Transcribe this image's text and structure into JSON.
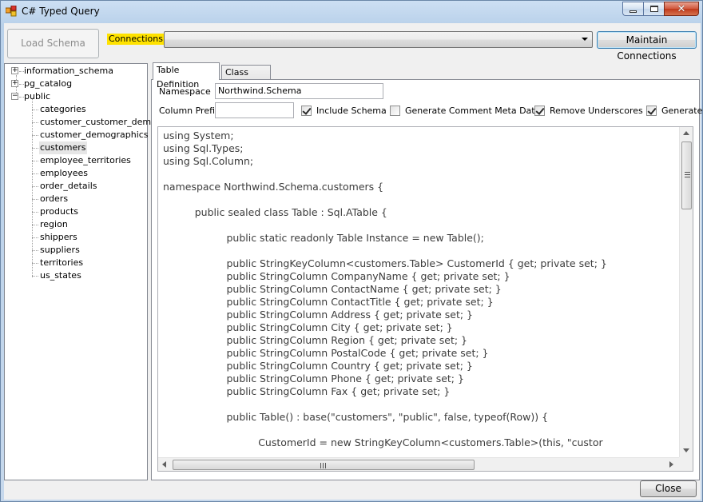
{
  "window": {
    "title": "C# Typed Query"
  },
  "toolbar": {
    "load_schema_label": "Load Schema",
    "connections_label": "Connections",
    "connections_value": "",
    "maintain_connections_label": "Maintain Connections"
  },
  "tree": {
    "roots": [
      {
        "label": "information_schema",
        "expander": "+"
      },
      {
        "label": "pg_catalog",
        "expander": "+"
      },
      {
        "label": "public",
        "expander": "−"
      }
    ],
    "children": [
      "categories",
      "customer_customer_demo",
      "customer_demographics",
      "customers",
      "employee_territories",
      "employees",
      "order_details",
      "orders",
      "products",
      "region",
      "shippers",
      "suppliers",
      "territories",
      "us_states"
    ]
  },
  "tabs": [
    {
      "label": "Table Definition"
    },
    {
      "label": "Class Code"
    }
  ],
  "form": {
    "namespace_label": "Namespace",
    "namespace_value": "Northwind.Schema",
    "column_prefix_label": "Column Prefix",
    "column_prefix_value": "",
    "include_schema_label": "Include Schema",
    "generate_comment_label": "Generate Comment Meta Data",
    "remove_underscores_label": "Remove Underscores",
    "generate_label": "Generate"
  },
  "code_lines": [
    "using System;",
    "using Sql.Types;",
    "using Sql.Column;",
    "",
    "namespace Northwind.Schema.customers {",
    "",
    "          public sealed class Table : Sql.ATable {",
    "",
    "                    public static readonly Table Instance = new Table();",
    "",
    "                    public StringKeyColumn<customers.Table> CustomerId { get; private set; }",
    "                    public StringColumn CompanyName { get; private set; }",
    "                    public StringColumn ContactName { get; private set; }",
    "                    public StringColumn ContactTitle { get; private set; }",
    "                    public StringColumn Address { get; private set; }",
    "                    public StringColumn City { get; private set; }",
    "                    public StringColumn Region { get; private set; }",
    "                    public StringColumn PostalCode { get; private set; }",
    "                    public StringColumn Country { get; private set; }",
    "                    public StringColumn Phone { get; private set; }",
    "                    public StringColumn Fax { get; private set; }",
    "",
    "                    public Table() : base(\"customers\", \"public\", false, typeof(Row)) {",
    "",
    "                              CustomerId = new StringKeyColumn<customers.Table>(this, \"custor"
  ],
  "footer": {
    "close_label": "Close"
  },
  "colors": {
    "connections_highlight": "#ffe200",
    "selected_node": "#e6e6e6"
  }
}
